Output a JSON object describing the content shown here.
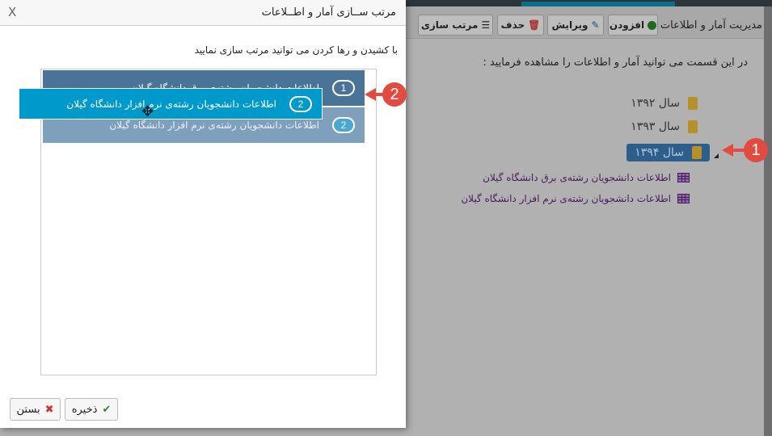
{
  "background": {
    "toolbar": {
      "title": "مدیریت آمار و اطلاعات :",
      "add": "افزودن",
      "edit": "ویرایش",
      "delete": "حذف",
      "sort": "مرتب سازی"
    },
    "intro": "در این قسمت می توانید آمار و اطلاعات را مشاهده فرمایید :",
    "tree": {
      "years": [
        "سال ۱۳۹۲",
        "سال ۱۳۹۳",
        "سال ۱۳۹۴"
      ],
      "selected_index": 2,
      "children": [
        "اطلاعات دانشجویان رشته‌ی برق دانشگاه گیلان",
        "اطلاعات دانشجویان رشته‌ی نرم افزار دانشگاه گیلان"
      ]
    }
  },
  "markers": [
    "1",
    "2"
  ],
  "colors": {
    "accent": "#0099cc",
    "marker": "#e24b40",
    "item1": "#4a7398",
    "item2": "#7fa0bc"
  },
  "modal": {
    "title": "مرتب ســازی آمار و اطــلاعات",
    "close_glyph": "X",
    "instruction": "با کشیدن و رها کردن می توانید مرتب سازی نمایید",
    "items": [
      {
        "num": "1",
        "label": "اطلاعات دانشجویان رشته‌ی برق دانشگاه گیلان"
      },
      {
        "num": "2",
        "label": "اطلاعات دانشجویان رشته‌ی نرم افزار دانشگاه گیلان"
      }
    ],
    "dragging": {
      "num": "2",
      "label": "اطلاعات دانشجویان رشته‌ی نرم افزار دانشگاه گیلان"
    },
    "save": "ذخیره",
    "cancel": "بستن"
  }
}
